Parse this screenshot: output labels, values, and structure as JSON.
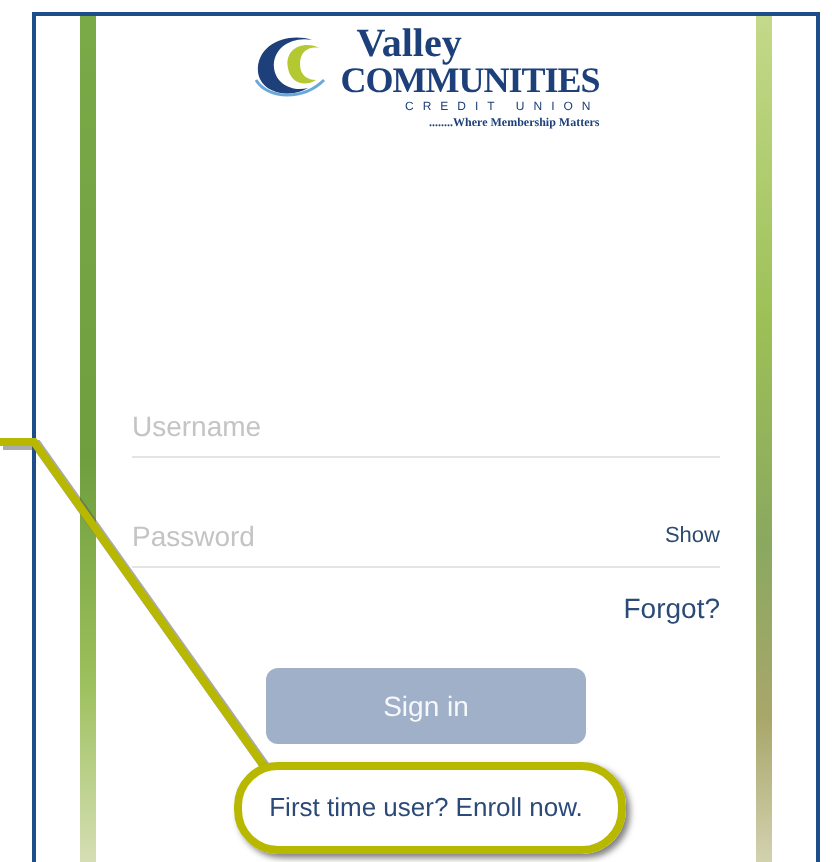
{
  "logo": {
    "name_top": "Valley",
    "name_main": "COMMUNITIES",
    "subtitle": "CREDIT UNION",
    "tagline": "........Where Membership Matters"
  },
  "username": {
    "placeholder": "Username"
  },
  "password": {
    "placeholder": "Password",
    "toggle": "Show"
  },
  "forgot": "Forgot?",
  "sign_in": {
    "label": "Sign in",
    "disabled": true
  },
  "enroll": "First time user? Enroll now."
}
